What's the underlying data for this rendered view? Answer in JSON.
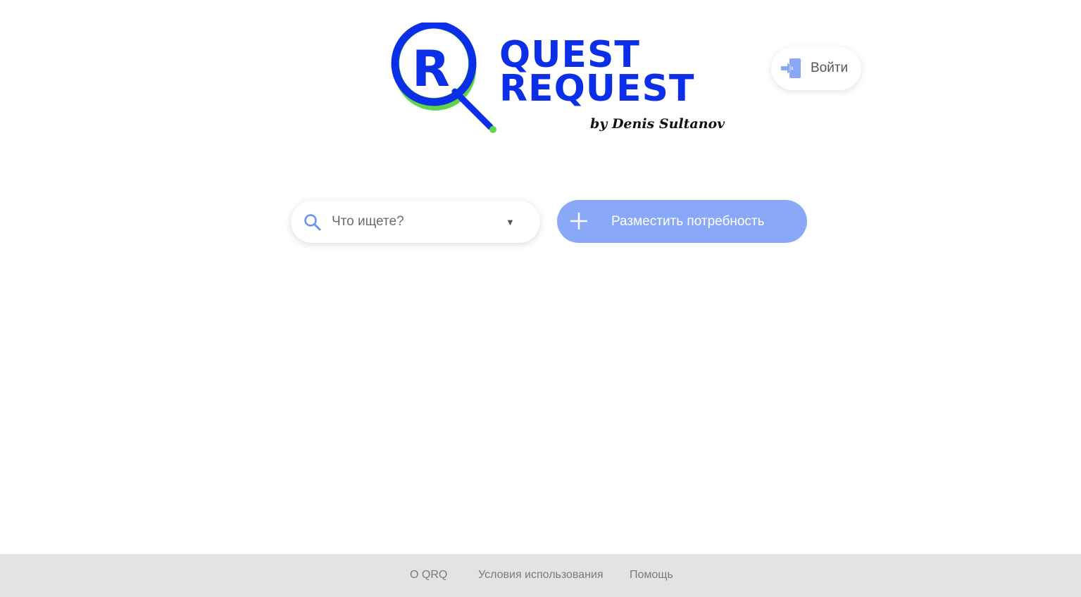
{
  "brand": {
    "logo_line1": "QUEST",
    "logo_line2": "REQUEST",
    "byline": "by Denis Sultanov",
    "logo_letter": "R",
    "primary_color": "#0b2ee8",
    "secondary_color": "#5fd64a"
  },
  "header": {
    "login_label": "Войти",
    "login_icon": "sign-in-icon"
  },
  "search": {
    "placeholder": "Что ищете?",
    "value": "",
    "icon": "search-icon",
    "dropdown_icon": "caret-down-icon"
  },
  "post_need": {
    "label": "Разместить потребность",
    "icon": "plus-icon",
    "color": "#8aa8f8"
  },
  "footer": {
    "links": [
      {
        "label": "О QRQ"
      },
      {
        "label": "Условия использования"
      },
      {
        "label": "Помощь"
      }
    ]
  }
}
